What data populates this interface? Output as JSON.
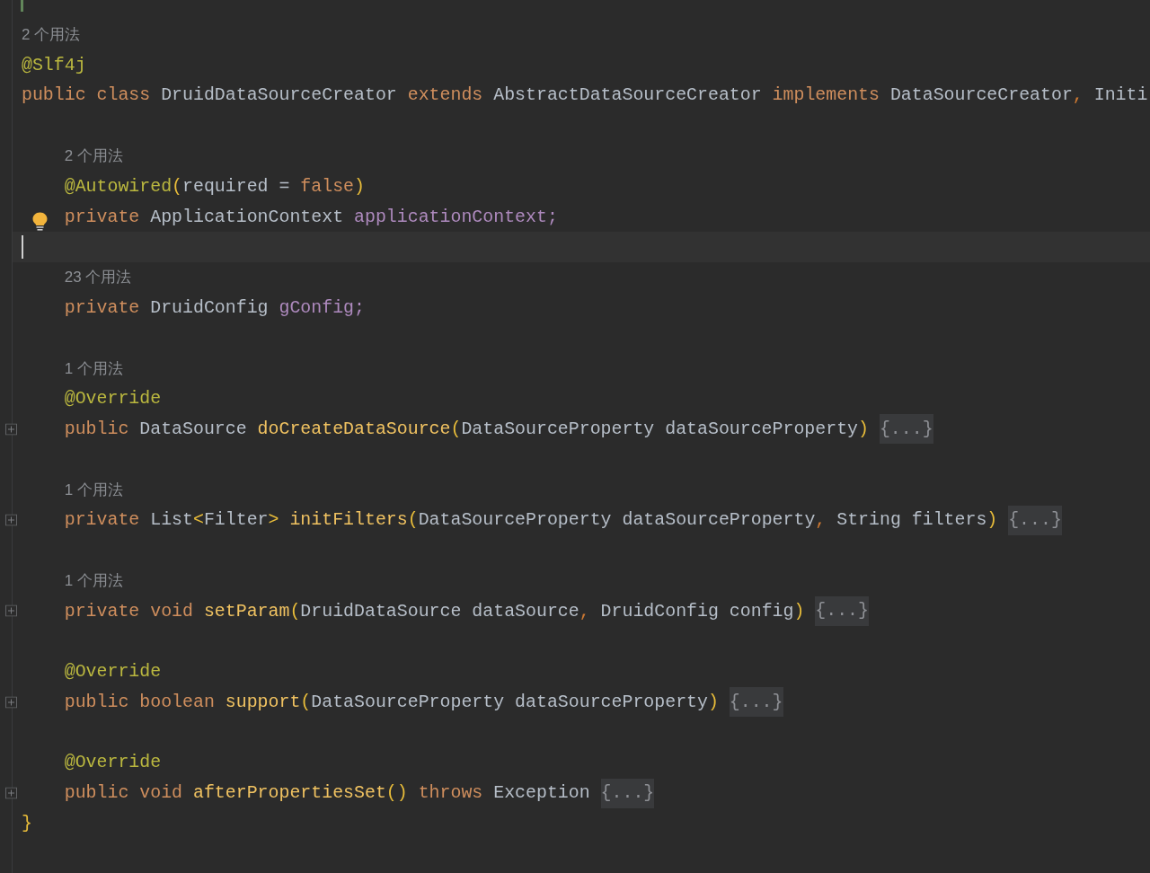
{
  "editor": {
    "class_hint": "2 个用法",
    "header": [
      {
        "tokens": [
          {
            "kind": "annotation",
            "text": "@Slf4j"
          }
        ]
      },
      {
        "tokens": [
          {
            "kind": "keyword",
            "text": "public "
          },
          {
            "kind": "keyword",
            "text": "class "
          },
          {
            "kind": "plain",
            "text": "DruidDataSourceCreator "
          },
          {
            "kind": "keyword",
            "text": "extends "
          },
          {
            "kind": "plain",
            "text": "AbstractDataSourceCreator "
          },
          {
            "kind": "keyword",
            "text": "implements "
          },
          {
            "kind": "plain",
            "text": "DataSourceCreator"
          },
          {
            "kind": "comma",
            "text": ", "
          },
          {
            "kind": "plain",
            "text": "Initi"
          }
        ]
      }
    ],
    "body": [
      {
        "kind": "blank"
      },
      {
        "kind": "member",
        "hint": "2 个用法",
        "lines": [
          {
            "tokens": [
              {
                "kind": "annotation",
                "text": "@Autowired"
              },
              {
                "kind": "bracket",
                "text": "("
              },
              {
                "kind": "plain",
                "text": "required = "
              },
              {
                "kind": "keyword",
                "text": "false"
              },
              {
                "kind": "bracket",
                "text": ")"
              }
            ]
          },
          {
            "intention": true,
            "tokens": [
              {
                "kind": "keyword",
                "text": "private "
              },
              {
                "kind": "plain",
                "text": "ApplicationContext "
              },
              {
                "kind": "field",
                "text": "applicationContext;"
              }
            ]
          }
        ]
      },
      {
        "kind": "cursor_line"
      },
      {
        "kind": "member",
        "hint": "23 个用法",
        "lines": [
          {
            "tokens": [
              {
                "kind": "keyword",
                "text": "private "
              },
              {
                "kind": "plain",
                "text": "DruidConfig "
              },
              {
                "kind": "field",
                "text": "gConfig;"
              }
            ]
          }
        ]
      },
      {
        "kind": "blank"
      },
      {
        "kind": "member",
        "hint": "1 个用法",
        "lines": [
          {
            "tokens": [
              {
                "kind": "annotation",
                "text": "@Override"
              }
            ]
          },
          {
            "collapsed": true,
            "placeholder": "{...}",
            "tokens": [
              {
                "kind": "keyword",
                "text": "public "
              },
              {
                "kind": "plain",
                "text": "DataSource "
              },
              {
                "kind": "method",
                "text": "doCreateDataSource"
              },
              {
                "kind": "bracket",
                "text": "("
              },
              {
                "kind": "plain",
                "text": "DataSourceProperty dataSourceProperty"
              },
              {
                "kind": "bracket",
                "text": ")"
              }
            ]
          }
        ]
      },
      {
        "kind": "blank"
      },
      {
        "kind": "member",
        "hint": "1 个用法",
        "lines": [
          {
            "collapsed": true,
            "placeholder": "{...}",
            "tokens": [
              {
                "kind": "keyword",
                "text": "private "
              },
              {
                "kind": "plain",
                "text": "List"
              },
              {
                "kind": "bracket",
                "text": "<"
              },
              {
                "kind": "plain",
                "text": "Filter"
              },
              {
                "kind": "bracket",
                "text": "> "
              },
              {
                "kind": "method",
                "text": "initFilters"
              },
              {
                "kind": "bracket",
                "text": "("
              },
              {
                "kind": "plain",
                "text": "DataSourceProperty dataSourceProperty"
              },
              {
                "kind": "comma",
                "text": ", "
              },
              {
                "kind": "plain",
                "text": "String filters"
              },
              {
                "kind": "bracket",
                "text": ")"
              }
            ]
          }
        ]
      },
      {
        "kind": "blank"
      },
      {
        "kind": "member",
        "hint": "1 个用法",
        "lines": [
          {
            "collapsed": true,
            "placeholder": "{...}",
            "tokens": [
              {
                "kind": "keyword",
                "text": "private "
              },
              {
                "kind": "keyword",
                "text": "void "
              },
              {
                "kind": "method",
                "text": "setParam"
              },
              {
                "kind": "bracket",
                "text": "("
              },
              {
                "kind": "plain",
                "text": "DruidDataSource dataSource"
              },
              {
                "kind": "comma",
                "text": ", "
              },
              {
                "kind": "plain",
                "text": "DruidConfig config"
              },
              {
                "kind": "bracket",
                "text": ")"
              }
            ]
          }
        ]
      },
      {
        "kind": "blank"
      },
      {
        "kind": "member",
        "lines": [
          {
            "tokens": [
              {
                "kind": "annotation",
                "text": "@Override"
              }
            ]
          },
          {
            "collapsed": true,
            "placeholder": "{...}",
            "tokens": [
              {
                "kind": "keyword",
                "text": "public "
              },
              {
                "kind": "keyword",
                "text": "boolean "
              },
              {
                "kind": "method",
                "text": "support"
              },
              {
                "kind": "bracket",
                "text": "("
              },
              {
                "kind": "plain",
                "text": "DataSourceProperty dataSourceProperty"
              },
              {
                "kind": "bracket",
                "text": ")"
              }
            ]
          }
        ]
      },
      {
        "kind": "blank"
      },
      {
        "kind": "member",
        "lines": [
          {
            "tokens": [
              {
                "kind": "annotation",
                "text": "@Override"
              }
            ]
          },
          {
            "collapsed": true,
            "placeholder": "{...}",
            "tokens": [
              {
                "kind": "keyword",
                "text": "public "
              },
              {
                "kind": "keyword",
                "text": "void "
              },
              {
                "kind": "method",
                "text": "afterPropertiesSet"
              },
              {
                "kind": "bracket",
                "text": "()"
              },
              {
                "kind": "keyword",
                "text": " throws "
              },
              {
                "kind": "plain",
                "text": "Exception"
              }
            ]
          }
        ]
      }
    ],
    "footer": [
      {
        "tokens": [
          {
            "kind": "bracket",
            "text": "}"
          }
        ]
      }
    ]
  }
}
